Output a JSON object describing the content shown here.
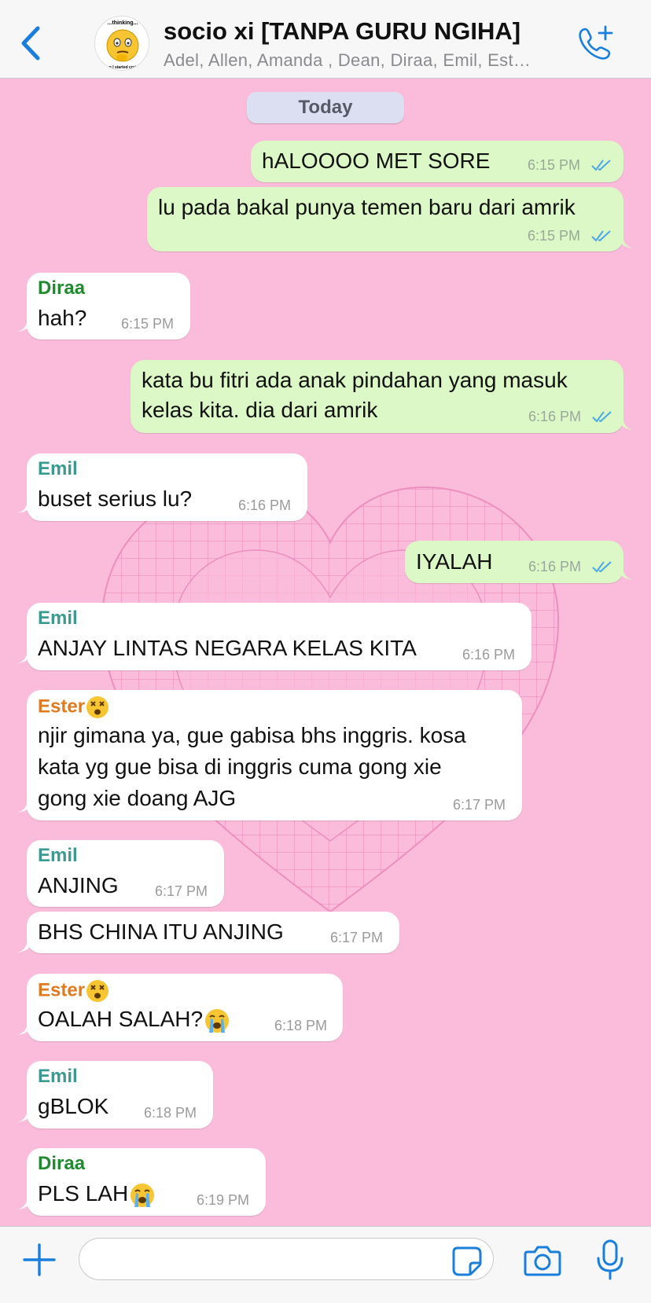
{
  "header": {
    "title": "socio xi [TANPA GURU NGIHA]",
    "members": "Adel, Allen, Amanda , Dean, Diraa, Emil, Est…",
    "back_icon": "chevron-left-icon",
    "call_icon": "add-call-icon",
    "avatar_top": "...thinking...",
    "avatar_bottom": "...en I started cryin..."
  },
  "date_label": "Today",
  "colors": {
    "background": "#fbbcdb",
    "outgoing": "#dcf8c6",
    "incoming": "#ffffff",
    "accent": "#1a7fdc"
  },
  "messages": [
    {
      "text": "hALOOOO MET SORE",
      "time": "6:15 PM"
    },
    {
      "text": "lu pada bakal punya temen baru dari amrik",
      "time": "6:15 PM"
    },
    {
      "sender": "Diraa",
      "text": "hah?",
      "time": "6:15 PM"
    },
    {
      "line1": "kata bu fitri ada anak pindahan yang masuk",
      "line2": "kelas kita. dia dari amrik",
      "time": "6:16 PM"
    },
    {
      "sender": "Emil",
      "text": "buset serius lu?",
      "time": "6:16 PM"
    },
    {
      "text": "IYALAH",
      "time": "6:16 PM"
    },
    {
      "sender": "Emil",
      "text": "ANJAY LINTAS NEGARA KELAS KITA",
      "time": "6:16 PM"
    },
    {
      "sender": "Ester",
      "line1": "njir gimana ya, gue gabisa bhs inggris. kosa",
      "line2": "kata yg gue bisa di inggris cuma gong xie",
      "line3": "gong xie doang AJG",
      "time": "6:17 PM"
    },
    {
      "sender": "Emil",
      "text": "ANJING",
      "time": "6:17 PM"
    },
    {
      "text": "BHS CHINA ITU ANJING",
      "time": "6:17 PM"
    },
    {
      "sender": "Ester",
      "text": "OALAH SALAH?",
      "time": "6:18 PM"
    },
    {
      "sender": "Emil",
      "text": "gBLOK",
      "time": "6:18 PM"
    },
    {
      "sender": "Diraa",
      "text": "PLS LAH",
      "time": "6:19 PM"
    }
  ],
  "input": {
    "placeholder": ""
  }
}
